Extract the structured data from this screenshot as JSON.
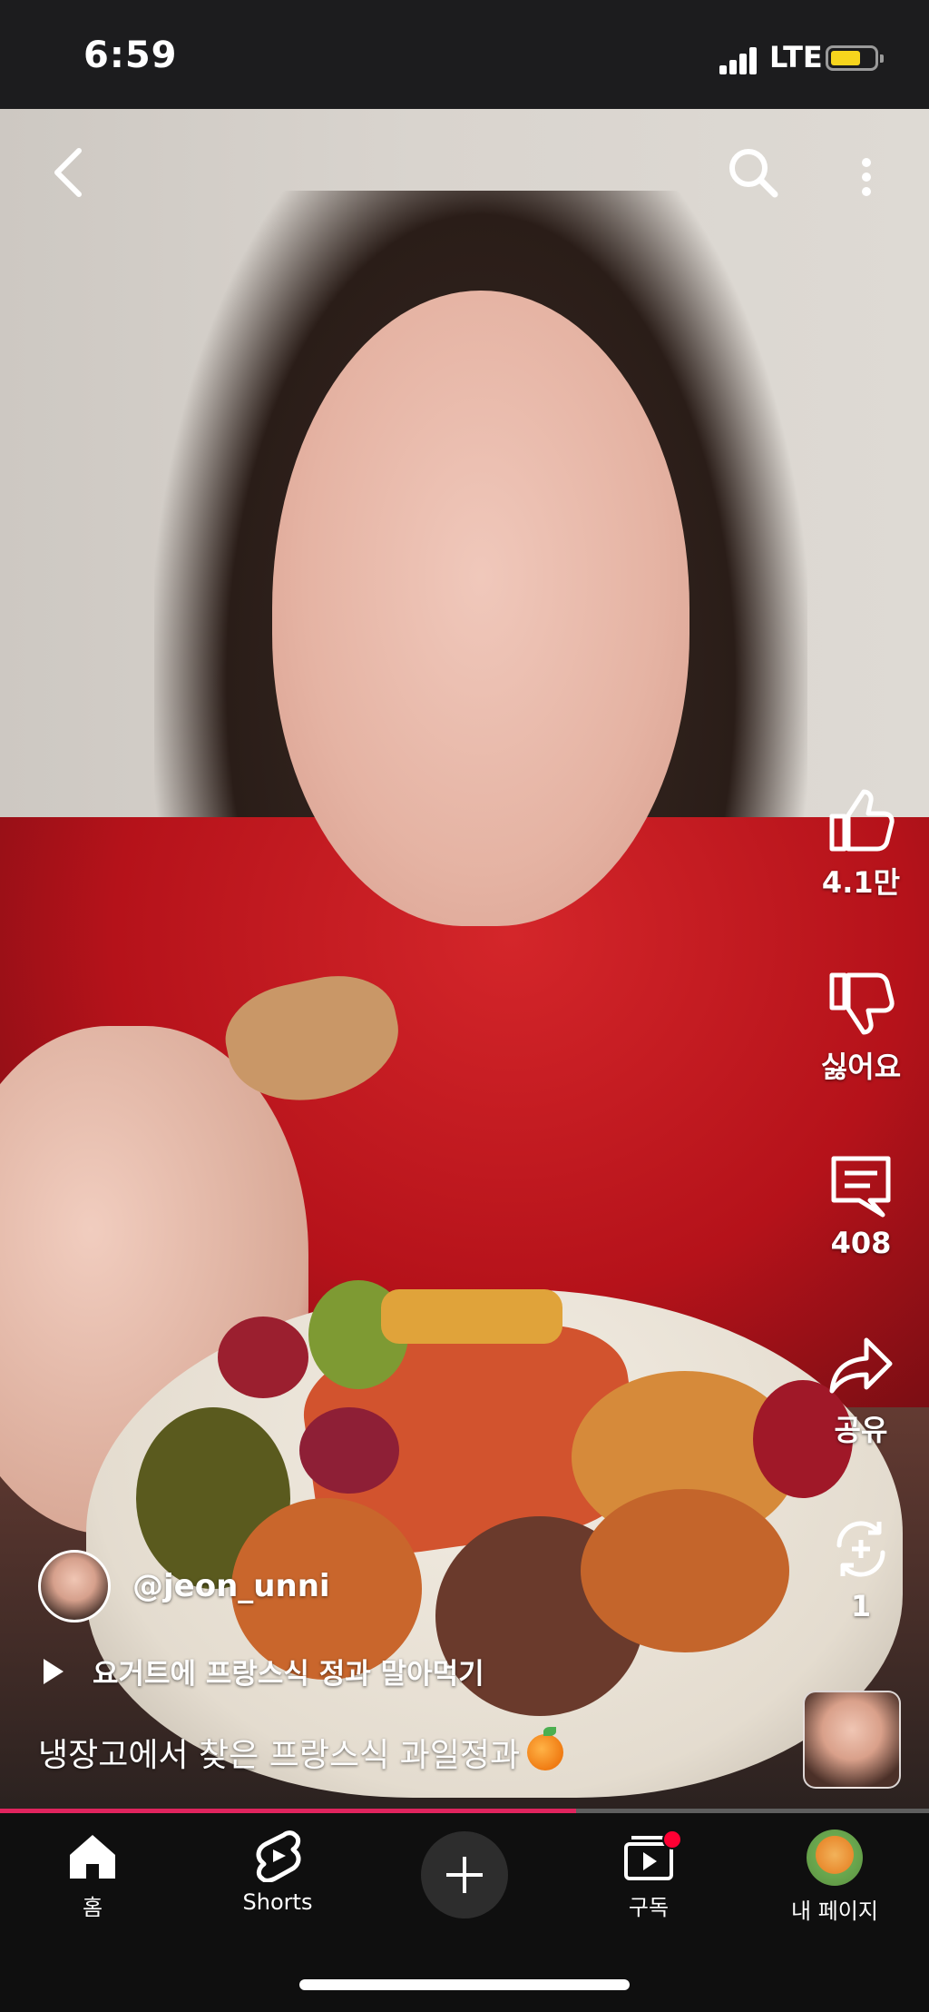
{
  "status_bar": {
    "time": "6:59",
    "network": "LTE",
    "battery_level": 0.7
  },
  "video": {
    "channel_handle": "@jeon_unni",
    "playlist_label": "요거트에 프랑스식 정과 말아먹기",
    "title": "냉장고에서 찾은 프랑스식 과일정과",
    "title_emoji": "orange-emoji",
    "progress": 0.62
  },
  "actions": {
    "like_count": "4.1만",
    "dislike_label": "싫어요",
    "comment_count": "408",
    "share_label": "공유",
    "remix_count": "1"
  },
  "top_icons": [
    "back-icon",
    "search-icon",
    "more-vertical-icon"
  ],
  "nav": {
    "home": "홈",
    "shorts": "Shorts",
    "subscriptions": "구독",
    "my_page": "내 페이지"
  },
  "colors": {
    "accent": "#ff0033",
    "progress": "#e0245e",
    "battery": "#f7d51d"
  }
}
